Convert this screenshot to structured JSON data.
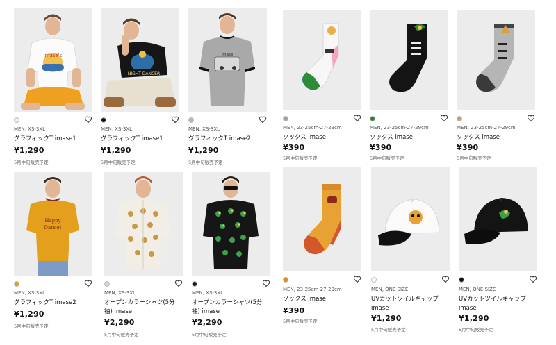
{
  "products": [
    {
      "id": "p1",
      "size": "MEN, XS-3XL",
      "name": "グラフィックT imase1",
      "price": "¥1,290",
      "note": "5月中旬販売予定",
      "swatch": "#f1eaf7",
      "icon": "heart-icon"
    },
    {
      "id": "p2",
      "size": "MEN, XS-3XL",
      "name": "グラフィックT imase1",
      "price": "¥1,290",
      "note": "5月中旬販売予定",
      "swatch": "#111111",
      "icon": "heart-icon"
    },
    {
      "id": "p3",
      "size": "MEN, XS-3XL",
      "name": "グラフィックT imase2",
      "price": "¥1,290",
      "note": "5月中旬販売予定",
      "swatch": "#b7b7b7",
      "icon": "heart-icon"
    },
    {
      "id": "p4",
      "size": "MEN, 23-25cm-27-29cm",
      "name": "ソックス imase",
      "price": "¥390",
      "note": "5月中旬販売予定",
      "swatch": "#9aa3a8",
      "icon": "heart-icon"
    },
    {
      "id": "p5",
      "size": "MEN, 23-25cm-27-29cm",
      "name": "ソックス imase",
      "price": "¥390",
      "note": "5月中旬販売予定",
      "swatch": "#2e7d32",
      "icon": "heart-icon"
    },
    {
      "id": "p6",
      "size": "MEN, 23-25cm-27-29cm",
      "name": "ソックス imase",
      "price": "¥390",
      "note": "5月中旬販売予定",
      "swatch": "#c9a07a",
      "icon": "heart-icon"
    },
    {
      "id": "p7",
      "size": "MEN, XS-3XL",
      "name": "グラフィックT imase2",
      "price": "¥1,290",
      "note": "5月中旬販売予定",
      "swatch": "#e0a21b",
      "icon": "heart-icon"
    },
    {
      "id": "p8",
      "size": "MEN, XS-3XL",
      "name_line1": "オープンカラーシャツ(5分",
      "name_line2": "袖) imase",
      "price": "¥2,290",
      "note": "5月中旬販売予定",
      "swatch": "#d9d2c2",
      "icon": "heart-icon"
    },
    {
      "id": "p9",
      "size": "MEN, XS-3XL",
      "name_line1": "オープンカラーシャツ(5分",
      "name_line2": "袖) imase",
      "price": "¥2,290",
      "note": "5月中旬販売予定",
      "swatch": "#1b1b1b",
      "icon": "heart-icon"
    },
    {
      "id": "p10",
      "size": "MEN, 23-25cm-27-29cm",
      "name": "ソックス imase",
      "price": "¥390",
      "note": "5月中旬販売予定",
      "swatch": "#d98a2b",
      "icon": "heart-icon"
    },
    {
      "id": "p11",
      "size": "MEN, ONE SIZE",
      "name_line1": "UVカットツイルキャップ",
      "name_line2": "imase",
      "price": "¥1,290",
      "note": "5月中旬販売予定",
      "swatch": "#ffffff",
      "icon": "heart-icon"
    },
    {
      "id": "p12",
      "size": "MEN, ONE SIZE",
      "name_line1": "UVカットツイルキャップ",
      "name_line2": "imase",
      "price": "¥1,290",
      "note": "5月中旬販売予定",
      "swatch": "#111111",
      "icon": "heart-icon"
    }
  ],
  "graphics": {
    "p1_print": "imase's",
    "p2_print": "NIGHT DANCER",
    "p3_print": "imase",
    "p7_print_1": "Happy",
    "p7_print_2": "Dance!"
  },
  "colors": {
    "accent_orange": "#f0a020",
    "shirt_black": "#161616",
    "shirt_gray": "#a9a9a9",
    "shirt_yellow": "#e4a01c",
    "sock_green": "#2e8b3a",
    "sock_pink": "#f4a6c0"
  }
}
